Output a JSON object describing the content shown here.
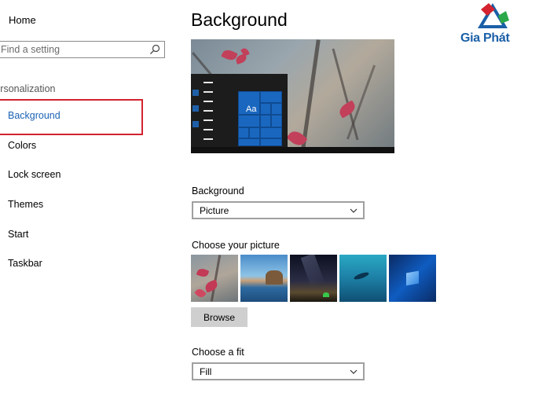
{
  "sidebar": {
    "home_label": "Home",
    "search_placeholder": "Find a setting",
    "section_label": "Personalization",
    "items": [
      {
        "label": "Background"
      },
      {
        "label": "Colors"
      },
      {
        "label": "Lock screen"
      },
      {
        "label": "Themes"
      },
      {
        "label": "Start"
      },
      {
        "label": "Taskbar"
      }
    ]
  },
  "main": {
    "title": "Background",
    "preview_tile_text": "Aa",
    "background_field": {
      "label": "Background",
      "value": "Picture"
    },
    "picture_field": {
      "label": "Choose your picture"
    },
    "browse_label": "Browse",
    "fit_field": {
      "label": "Choose a fit",
      "value": "Fill"
    }
  },
  "logo": {
    "text": "Gia Phát"
  },
  "colors": {
    "accent": "#1a63b4",
    "highlight": "#d4232f",
    "tile": "#1a67c0"
  }
}
